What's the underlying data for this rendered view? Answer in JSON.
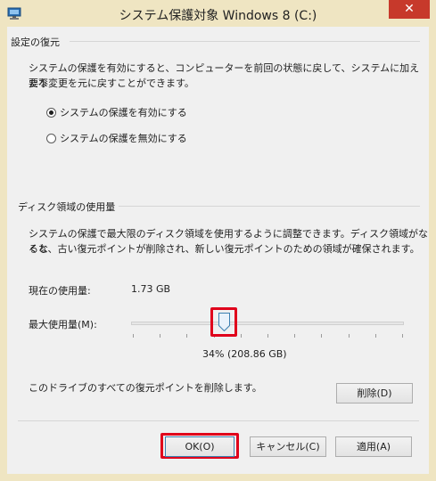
{
  "window": {
    "title": "システム保護対象 Windows 8 (C:)",
    "close_glyph": "✕"
  },
  "restore_settings": {
    "group_label": "設定の復元",
    "description_line1": "システムの保護を有効にすると、コンピューターを前回の状態に戻して、システムに加えた不",
    "description_line2": "要な変更を元に戻すことができます。",
    "options": [
      {
        "label": "システムの保護を有効にする",
        "checked": true
      },
      {
        "label": "システムの保護を無効にする",
        "checked": false
      }
    ]
  },
  "disk_usage": {
    "group_label": "ディスク領域の使用量",
    "description_line1": "システムの保護で最大限のディスク領域を使用するように調整できます。ディスク領域がなくな",
    "description_line2": "ると、古い復元ポイントが削除され、新しい復元ポイントのための領域が確保されます。",
    "current_usage_label": "現在の使用量:",
    "current_usage_value": "1.73 GB",
    "max_usage_label": "最大使用量(M):",
    "max_usage_percent": 34,
    "max_usage_readout": "34% (208.86 GB)",
    "delete_description": "このドライブのすべての復元ポイントを削除します。",
    "delete_button": "削除(D)"
  },
  "footer": {
    "ok_button": "OK(O)",
    "cancel_button": "キャンセル(C)",
    "apply_button": "適用(A)"
  },
  "colors": {
    "title_bar": "#efe5c2",
    "close_button": "#c7392b",
    "highlight": "#e0001b",
    "dialog_background": "#f0f0f0"
  },
  "icons": {
    "app_icon": "system-protection-icon",
    "close_icon": "close-icon",
    "slider_thumb": "slider-thumb"
  }
}
